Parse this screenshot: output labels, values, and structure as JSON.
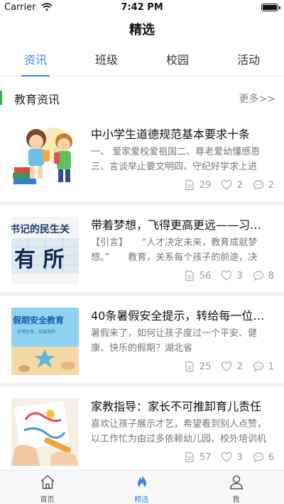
{
  "status_bar": {
    "carrier": "Carrier",
    "time": "7:42 PM"
  },
  "nav": {
    "title": "精选"
  },
  "tabs": [
    {
      "label": "资讯",
      "active": true
    },
    {
      "label": "班级",
      "active": false
    },
    {
      "label": "校园",
      "active": false
    },
    {
      "label": "活动",
      "active": false
    }
  ],
  "section": {
    "title": "教育资讯",
    "more": "更多>>"
  },
  "articles": [
    {
      "title": "中小学生道德规范基本要求十条",
      "desc": "一、 爱家爱校爱祖国二、尊老爱幼懂感恩三、言谈举止要文明四、守纪好学求上进",
      "views": "29",
      "likes": "2",
      "comments": "2"
    },
    {
      "title": "带着梦想，飞得更高更远——习…",
      "desc": "【引言】　　“人才决定未来，教育成就梦想。”　　教育，关系每个孩子的前途，决",
      "thumb_text_top": "书记的民生关",
      "thumb_text_big": "有 所",
      "views": "56",
      "likes": "3",
      "comments": "8"
    },
    {
      "title": "40条暑假安全提示，转给每一位…",
      "desc": "暑假来了，如何让孩子度过一个平安、健康、快乐的假期？湖北省",
      "thumb_text_top": "假期安全教育",
      "thumb_text_sub": "珍惜生命，远离危险",
      "views": "25",
      "likes": "2",
      "comments": "1"
    },
    {
      "title": "家教指导：家长不可推卸育儿责任",
      "desc": "喜欢让孩子展示才艺，希望看到别人点赞，以工作忙为由过多依赖幼儿园、校外培训机",
      "views": "57",
      "likes": "3",
      "comments": "6"
    }
  ],
  "bottom_nav": [
    {
      "label": "首页",
      "icon": "home-icon",
      "active": false
    },
    {
      "label": "精选",
      "icon": "flame-icon",
      "active": true
    },
    {
      "label": "我",
      "icon": "person-icon",
      "active": false
    }
  ],
  "colors": {
    "accent": "#2e8ee6",
    "section_bar": "#2db24a"
  }
}
